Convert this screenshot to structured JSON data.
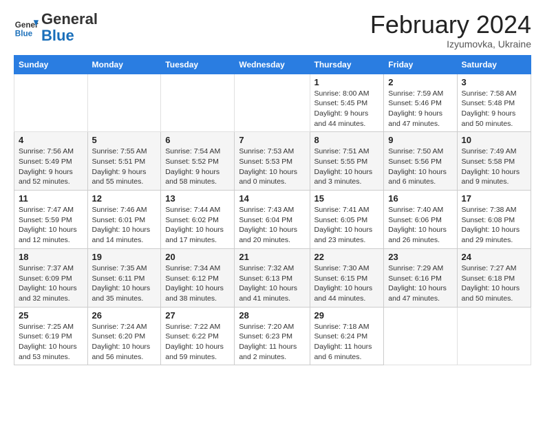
{
  "header": {
    "logo_general": "General",
    "logo_blue": "Blue",
    "title": "February 2024",
    "subtitle": "Izyumovka, Ukraine"
  },
  "columns": [
    "Sunday",
    "Monday",
    "Tuesday",
    "Wednesday",
    "Thursday",
    "Friday",
    "Saturday"
  ],
  "weeks": [
    [
      {
        "num": "",
        "info": ""
      },
      {
        "num": "",
        "info": ""
      },
      {
        "num": "",
        "info": ""
      },
      {
        "num": "",
        "info": ""
      },
      {
        "num": "1",
        "info": "Sunrise: 8:00 AM\nSunset: 5:45 PM\nDaylight: 9 hours\nand 44 minutes."
      },
      {
        "num": "2",
        "info": "Sunrise: 7:59 AM\nSunset: 5:46 PM\nDaylight: 9 hours\nand 47 minutes."
      },
      {
        "num": "3",
        "info": "Sunrise: 7:58 AM\nSunset: 5:48 PM\nDaylight: 9 hours\nand 50 minutes."
      }
    ],
    [
      {
        "num": "4",
        "info": "Sunrise: 7:56 AM\nSunset: 5:49 PM\nDaylight: 9 hours\nand 52 minutes."
      },
      {
        "num": "5",
        "info": "Sunrise: 7:55 AM\nSunset: 5:51 PM\nDaylight: 9 hours\nand 55 minutes."
      },
      {
        "num": "6",
        "info": "Sunrise: 7:54 AM\nSunset: 5:52 PM\nDaylight: 9 hours\nand 58 minutes."
      },
      {
        "num": "7",
        "info": "Sunrise: 7:53 AM\nSunset: 5:53 PM\nDaylight: 10 hours\nand 0 minutes."
      },
      {
        "num": "8",
        "info": "Sunrise: 7:51 AM\nSunset: 5:55 PM\nDaylight: 10 hours\nand 3 minutes."
      },
      {
        "num": "9",
        "info": "Sunrise: 7:50 AM\nSunset: 5:56 PM\nDaylight: 10 hours\nand 6 minutes."
      },
      {
        "num": "10",
        "info": "Sunrise: 7:49 AM\nSunset: 5:58 PM\nDaylight: 10 hours\nand 9 minutes."
      }
    ],
    [
      {
        "num": "11",
        "info": "Sunrise: 7:47 AM\nSunset: 5:59 PM\nDaylight: 10 hours\nand 12 minutes."
      },
      {
        "num": "12",
        "info": "Sunrise: 7:46 AM\nSunset: 6:01 PM\nDaylight: 10 hours\nand 14 minutes."
      },
      {
        "num": "13",
        "info": "Sunrise: 7:44 AM\nSunset: 6:02 PM\nDaylight: 10 hours\nand 17 minutes."
      },
      {
        "num": "14",
        "info": "Sunrise: 7:43 AM\nSunset: 6:04 PM\nDaylight: 10 hours\nand 20 minutes."
      },
      {
        "num": "15",
        "info": "Sunrise: 7:41 AM\nSunset: 6:05 PM\nDaylight: 10 hours\nand 23 minutes."
      },
      {
        "num": "16",
        "info": "Sunrise: 7:40 AM\nSunset: 6:06 PM\nDaylight: 10 hours\nand 26 minutes."
      },
      {
        "num": "17",
        "info": "Sunrise: 7:38 AM\nSunset: 6:08 PM\nDaylight: 10 hours\nand 29 minutes."
      }
    ],
    [
      {
        "num": "18",
        "info": "Sunrise: 7:37 AM\nSunset: 6:09 PM\nDaylight: 10 hours\nand 32 minutes."
      },
      {
        "num": "19",
        "info": "Sunrise: 7:35 AM\nSunset: 6:11 PM\nDaylight: 10 hours\nand 35 minutes."
      },
      {
        "num": "20",
        "info": "Sunrise: 7:34 AM\nSunset: 6:12 PM\nDaylight: 10 hours\nand 38 minutes."
      },
      {
        "num": "21",
        "info": "Sunrise: 7:32 AM\nSunset: 6:13 PM\nDaylight: 10 hours\nand 41 minutes."
      },
      {
        "num": "22",
        "info": "Sunrise: 7:30 AM\nSunset: 6:15 PM\nDaylight: 10 hours\nand 44 minutes."
      },
      {
        "num": "23",
        "info": "Sunrise: 7:29 AM\nSunset: 6:16 PM\nDaylight: 10 hours\nand 47 minutes."
      },
      {
        "num": "24",
        "info": "Sunrise: 7:27 AM\nSunset: 6:18 PM\nDaylight: 10 hours\nand 50 minutes."
      }
    ],
    [
      {
        "num": "25",
        "info": "Sunrise: 7:25 AM\nSunset: 6:19 PM\nDaylight: 10 hours\nand 53 minutes."
      },
      {
        "num": "26",
        "info": "Sunrise: 7:24 AM\nSunset: 6:20 PM\nDaylight: 10 hours\nand 56 minutes."
      },
      {
        "num": "27",
        "info": "Sunrise: 7:22 AM\nSunset: 6:22 PM\nDaylight: 10 hours\nand 59 minutes."
      },
      {
        "num": "28",
        "info": "Sunrise: 7:20 AM\nSunset: 6:23 PM\nDaylight: 11 hours\nand 2 minutes."
      },
      {
        "num": "29",
        "info": "Sunrise: 7:18 AM\nSunset: 6:24 PM\nDaylight: 11 hours\nand 6 minutes."
      },
      {
        "num": "",
        "info": ""
      },
      {
        "num": "",
        "info": ""
      }
    ]
  ]
}
